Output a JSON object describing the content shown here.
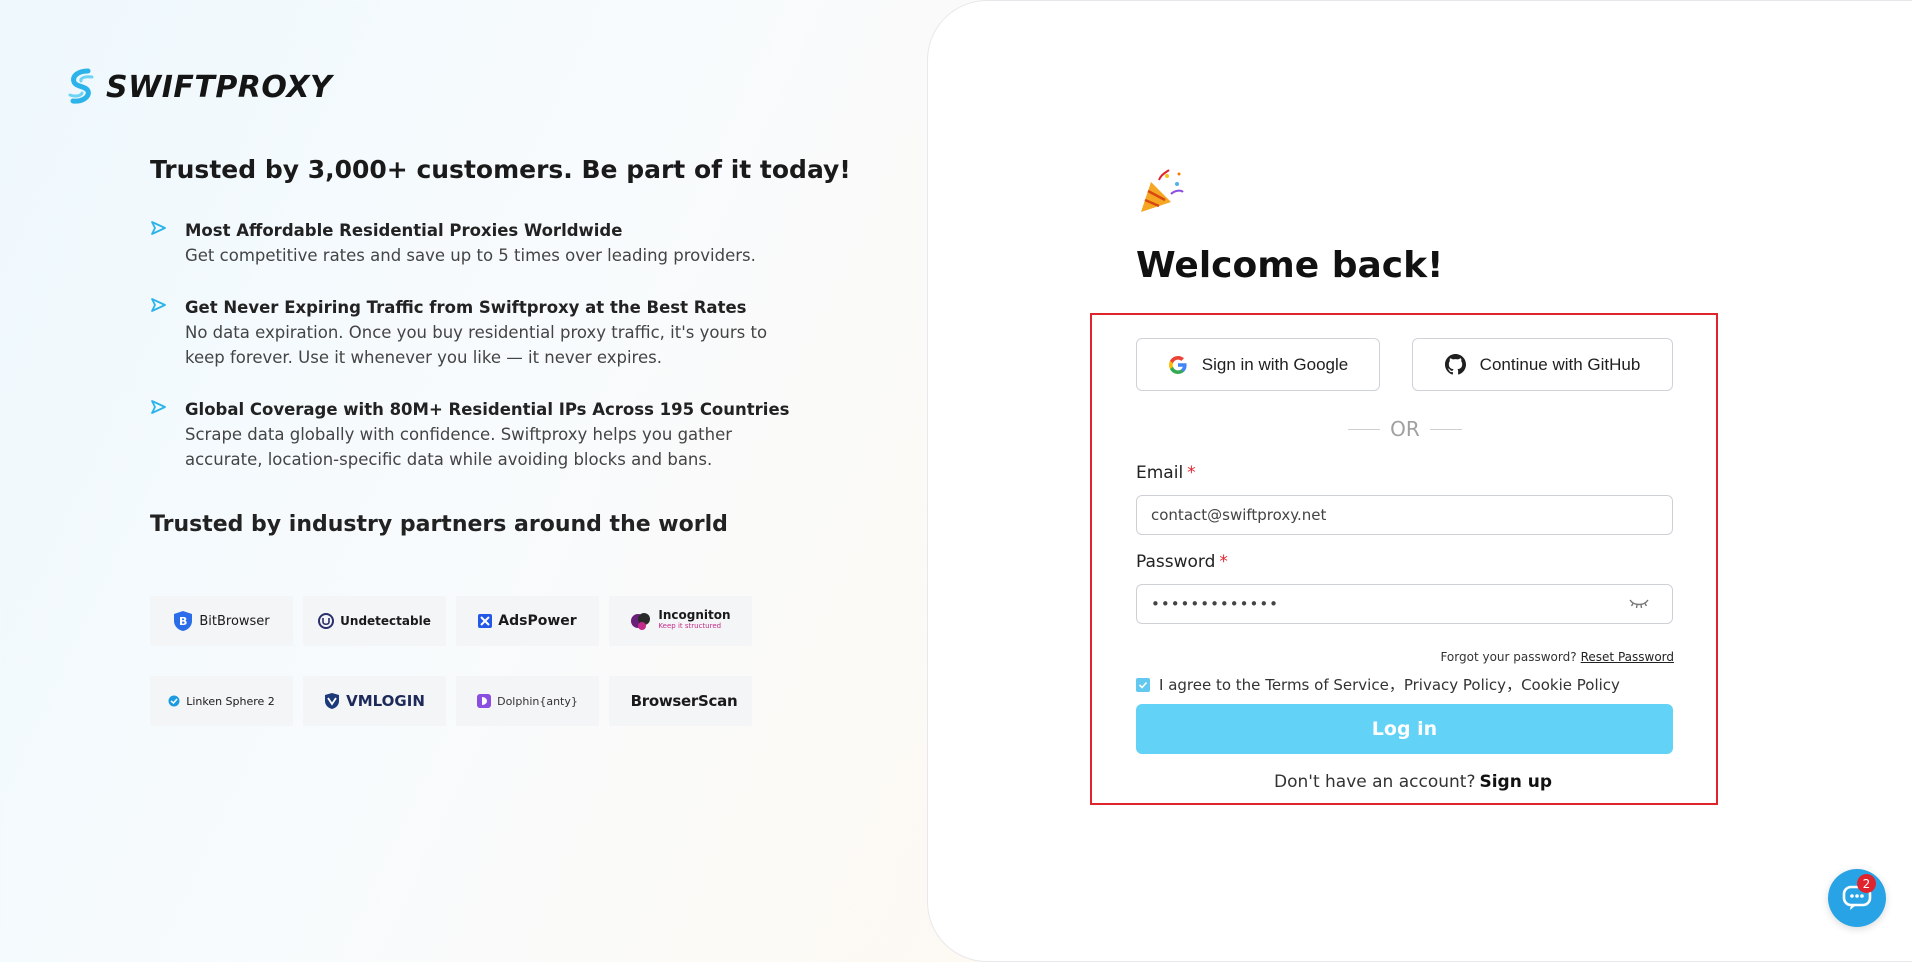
{
  "brand": {
    "name": "SWIFTPROXY"
  },
  "intro": {
    "headline": "Trusted by 3,000+ customers. Be part of it today!",
    "features": [
      {
        "title": "Most Affordable Residential Proxies Worldwide",
        "desc": "Get competitive rates and save up to 5 times over leading providers."
      },
      {
        "title": "Get Never Expiring Traffic from Swiftproxy at the Best Rates",
        "desc": "No data expiration. Once you buy residential proxy traffic, it's yours to keep forever. Use it whenever you like — it never expires."
      },
      {
        "title": "Global Coverage with 80M+ Residential IPs Across 195 Countries",
        "desc": "Scrape data globally with confidence. Swiftproxy helps you gather accurate, location-specific data while avoiding blocks and bans."
      }
    ],
    "partners_title": "Trusted by industry partners around the world",
    "partners": [
      {
        "name": "BitBrowser",
        "icon": "bitbrowser-logo-icon"
      },
      {
        "name": "Undetectable",
        "icon": "undetectable-logo-icon"
      },
      {
        "name": "AdsPower",
        "icon": "adspower-logo-icon"
      },
      {
        "name": "Incogniton",
        "tagline": "Keep it structured",
        "icon": "incogniton-logo-icon"
      },
      {
        "name": "Linken Sphere 2",
        "icon": "linken-sphere-logo-icon"
      },
      {
        "name": "VMLOGIN",
        "icon": "vmlogin-logo-icon"
      },
      {
        "name": "Dolphin{anty}",
        "icon": "dolphin-logo-icon"
      },
      {
        "name": "BrowserScan",
        "icon": "browserscan-logo-icon"
      }
    ]
  },
  "login": {
    "welcome": "Welcome back!",
    "google_label": "Sign in with Google",
    "github_label": "Continue with GitHub",
    "or_text": "OR",
    "email_label": "Email",
    "required_mark": "*",
    "email_value": "contact@swiftproxy.net",
    "password_label": "Password",
    "password_value": "•••••••••••••",
    "forgot_text": "Forgot your password?",
    "reset_label": "Reset Password",
    "agree_prefix": "I agree to the",
    "terms_label": "Terms of Service",
    "privacy_label": "Privacy Policy",
    "cookie_label": "Cookie Policy",
    "login_label": "Log in",
    "no_account_text": "Don't have an account?",
    "signup_label": "Sign up"
  },
  "chat": {
    "badge_count": "2"
  },
  "colors": {
    "accent": "#63d2f7",
    "required": "#e0242e",
    "chat": "#28a4e6"
  }
}
